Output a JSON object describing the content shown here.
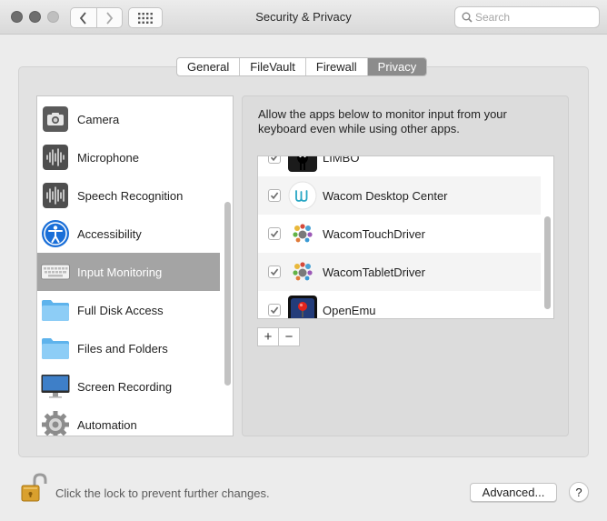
{
  "window": {
    "title": "Security & Privacy"
  },
  "toolbar": {
    "search_placeholder": "Search"
  },
  "tabs": [
    {
      "label": "General",
      "active": false
    },
    {
      "label": "FileVault",
      "active": false
    },
    {
      "label": "Firewall",
      "active": false
    },
    {
      "label": "Privacy",
      "active": true
    }
  ],
  "sidebar": {
    "selected": "Input Monitoring",
    "items": [
      {
        "label": "Camera",
        "icon": "camera-icon"
      },
      {
        "label": "Microphone",
        "icon": "microphone-icon"
      },
      {
        "label": "Speech Recognition",
        "icon": "speech-recognition-icon"
      },
      {
        "label": "Accessibility",
        "icon": "accessibility-icon"
      },
      {
        "label": "Input Monitoring",
        "icon": "keyboard-icon"
      },
      {
        "label": "Full Disk Access",
        "icon": "folder-icon"
      },
      {
        "label": "Files and Folders",
        "icon": "folder-icon"
      },
      {
        "label": "Screen Recording",
        "icon": "display-icon"
      },
      {
        "label": "Automation",
        "icon": "gear-icon"
      }
    ]
  },
  "panel": {
    "description": "Allow the apps below to monitor input from your keyboard even while using other apps.",
    "apps": [
      {
        "name": "LIMBO",
        "checked": true,
        "icon": "limbo-app-icon"
      },
      {
        "name": "Wacom Desktop Center",
        "checked": true,
        "icon": "wacom-app-icon"
      },
      {
        "name": "WacomTouchDriver",
        "checked": true,
        "icon": "wacom-driver-icon"
      },
      {
        "name": "WacomTabletDriver",
        "checked": true,
        "icon": "wacom-driver-icon"
      },
      {
        "name": "OpenEmu",
        "checked": true,
        "icon": "openemu-app-icon"
      }
    ],
    "add_label": "+",
    "remove_label": "−"
  },
  "footer": {
    "lock_text": "Click the lock to prevent further changes.",
    "advanced_label": "Advanced...",
    "help_label": "?"
  },
  "colors": {
    "selected_row": "#a4a4a4",
    "active_tab": "#8c8c8c",
    "checkbox": "#7a7a7a"
  }
}
